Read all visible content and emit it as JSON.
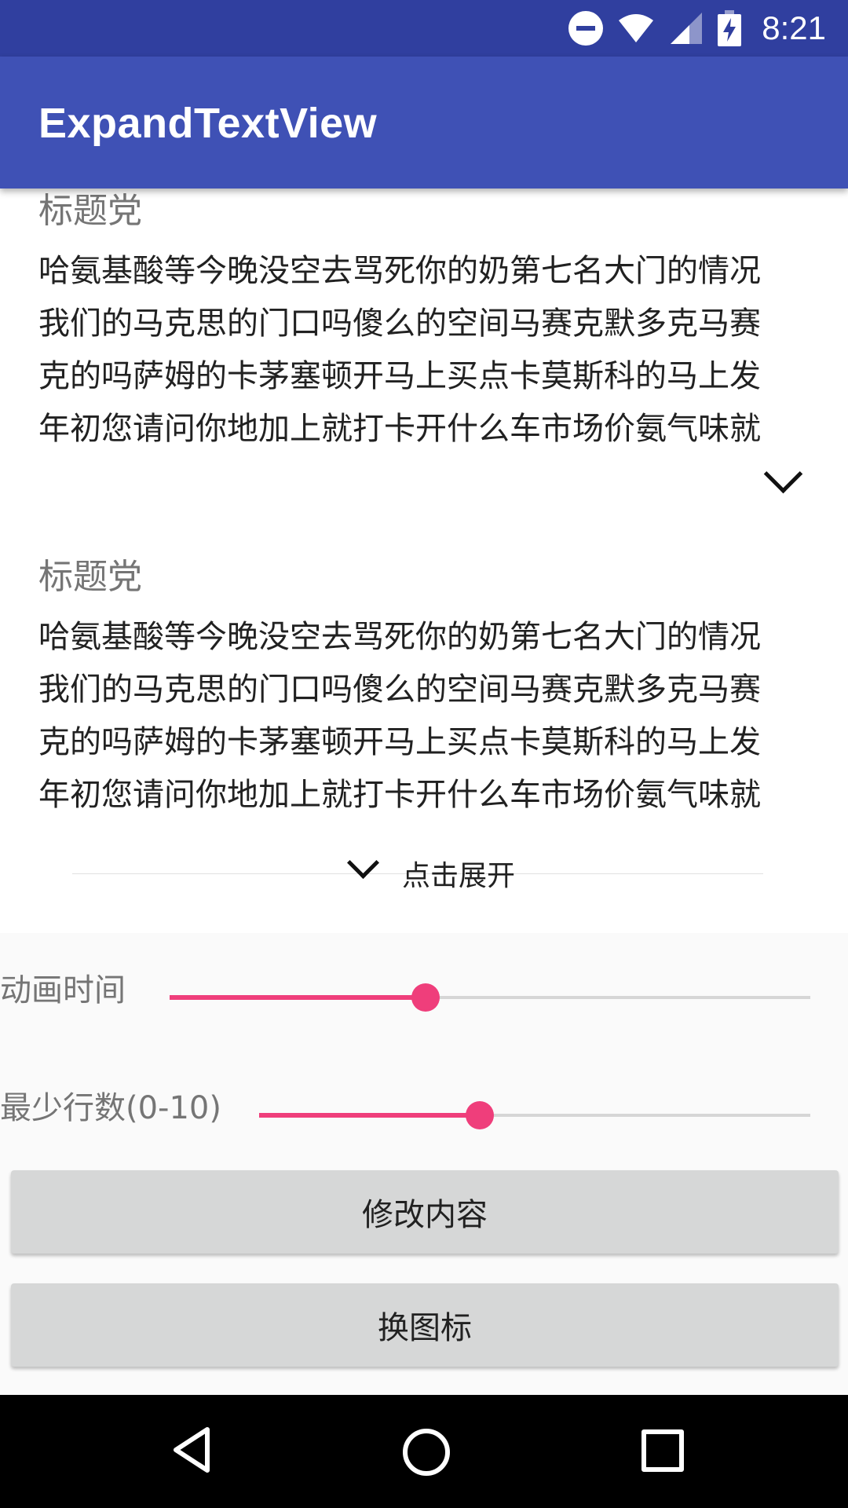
{
  "status_bar": {
    "time": "8:21",
    "icons": [
      "do-not-disturb-icon",
      "wifi-icon",
      "cellular-signal-icon",
      "battery-charging-icon"
    ]
  },
  "app_bar": {
    "title": "ExpandTextView"
  },
  "cards": [
    {
      "title": "标题党",
      "lines": [
        "哈氨基酸等今晚没空去骂死你的奶第七名大门的情况",
        "我们的马克思的门口吗傻么的空间马赛克默多克马赛",
        "克的吗萨姆的卡茅塞顿开马上买点卡莫斯科的马上发",
        "年初您请问你地加上就打卡开什么车市场价氨气味就"
      ],
      "expand_icon": "chevron-down-icon"
    },
    {
      "title": "标题党",
      "lines": [
        "哈氨基酸等今晚没空去骂死你的奶第七名大门的情况",
        "我们的马克思的门口吗傻么的空间马赛克默多克马赛",
        "克的吗萨姆的卡茅塞顿开马上买点卡莫斯科的马上发",
        "年初您请问你地加上就打卡开什么车市场价氨气味就"
      ],
      "expand_icon": "chevron-down-icon",
      "expand_label": "点击展开"
    }
  ],
  "settings": {
    "animation_time": {
      "label": "动画时间",
      "fraction": 0.4
    },
    "min_lines": {
      "label": "最少行数(0-10)",
      "fraction": 0.4
    }
  },
  "buttons": {
    "modify_content": "修改内容",
    "change_icon": "换图标"
  },
  "colors": {
    "status_bar": "#303F9F",
    "app_bar": "#3F51B5",
    "accent": "#ef3e7b"
  },
  "nav_bar": {
    "icons": [
      "back-icon",
      "home-icon",
      "recents-icon"
    ]
  }
}
